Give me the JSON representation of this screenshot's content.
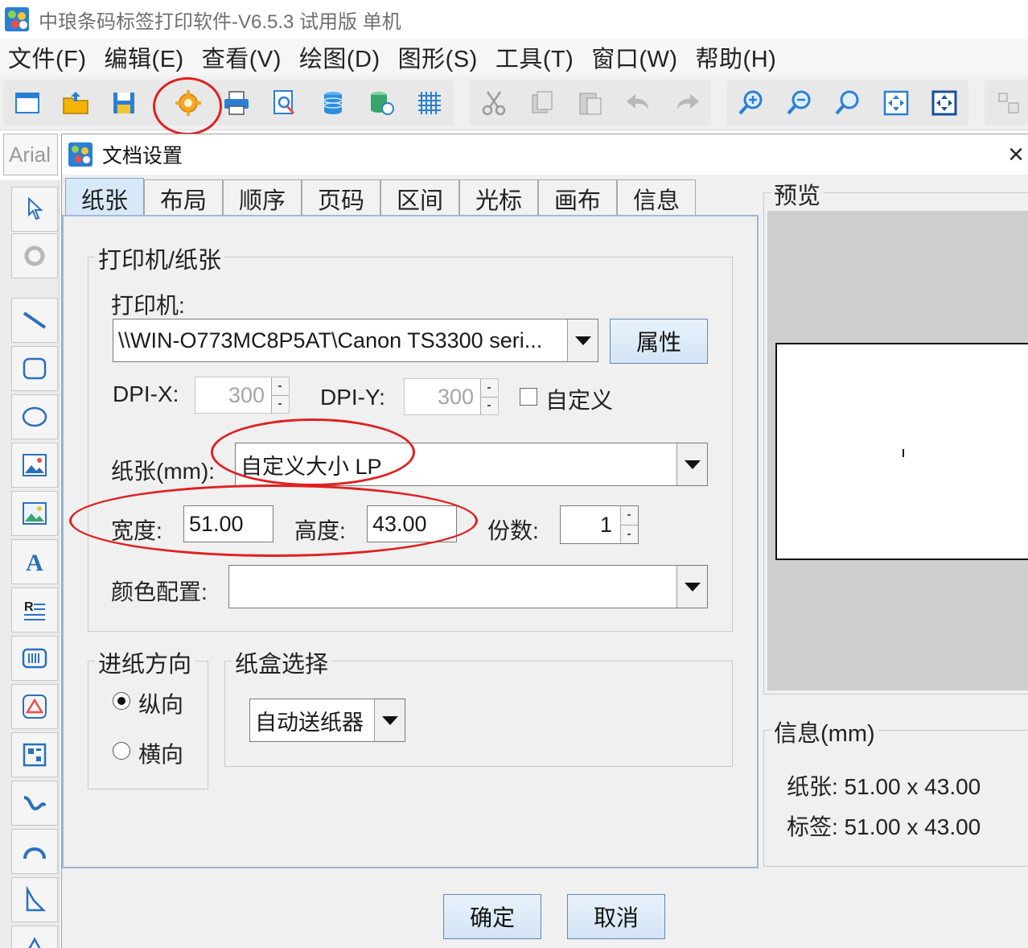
{
  "window": {
    "title": "中琅条码标签打印软件-V6.5.3 试用版 单机"
  },
  "menu": [
    "文件(F)",
    "编辑(E)",
    "查看(V)",
    "绘图(D)",
    "图形(S)",
    "工具(T)",
    "窗口(W)",
    "帮助(H)"
  ],
  "font_box": {
    "value": "Arial"
  },
  "dialog": {
    "title": "文档设置",
    "close_glyph": "×",
    "tabs": [
      "纸张",
      "布局",
      "顺序",
      "页码",
      "区间",
      "光标",
      "画布",
      "信息"
    ],
    "printer_paper": {
      "group_label": "打印机/纸张",
      "printer_label": "打印机:",
      "printer_value": "\\\\WIN-O773MC8P5AT\\Canon TS3300 seri...",
      "properties_button": "属性",
      "dpi_x_label": "DPI-X:",
      "dpi_x_value": "300",
      "dpi_y_label": "DPI-Y:",
      "dpi_y_value": "300",
      "custom_label": "自定义",
      "paper_label": "纸张(mm):",
      "paper_value": "自定义大小 LP",
      "width_label": "宽度:",
      "width_value": "51.00",
      "height_label": "高度:",
      "height_value": "43.00",
      "copies_label": "份数:",
      "copies_value": "1",
      "color_label": "颜色配置:",
      "color_value": ""
    },
    "feed": {
      "group_label": "进纸方向",
      "portrait": "纵向",
      "landscape": "横向",
      "selected": "纵向"
    },
    "tray": {
      "group_label": "纸盒选择",
      "value": "自动送纸器"
    },
    "preview": {
      "group_label": "预览"
    },
    "info": {
      "group_label": "信息(mm)",
      "paper_line": "纸张:  51.00 x 43.00",
      "label_line": "标签:  51.00 x 43.00"
    },
    "ok_button": "确定",
    "cancel_button": "取消"
  },
  "colors": {
    "accent": "#2a7fd4",
    "highlight": "#e02020",
    "active_tab": "#d7e8f8"
  }
}
